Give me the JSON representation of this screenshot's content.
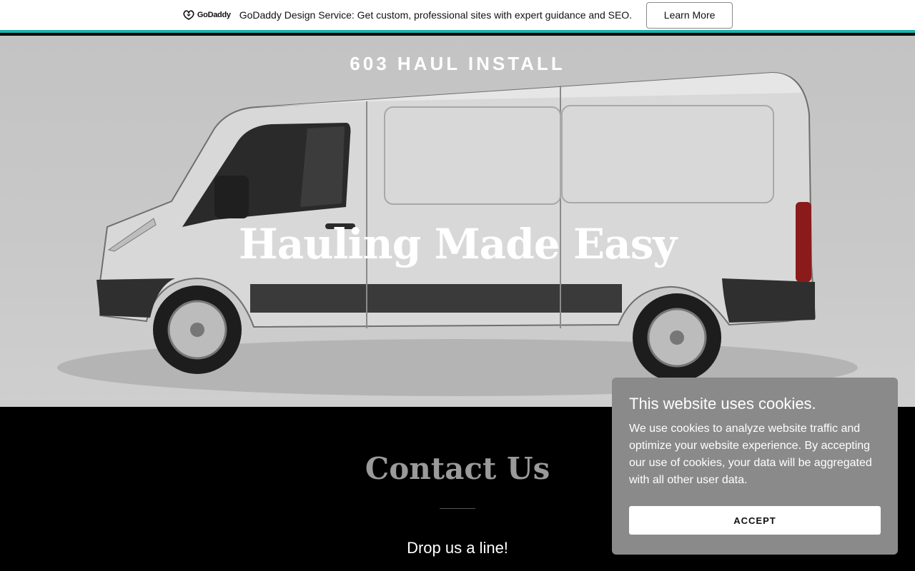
{
  "promo": {
    "logo_text": "GoDaddy",
    "message": "GoDaddy Design Service: Get custom, professional sites with expert guidance and SEO.",
    "button_label": "Learn More",
    "accent_color": "#1bb3ad"
  },
  "hero": {
    "site_title": "603 HAUL INSTALL",
    "heading": "Hauling Made Easy"
  },
  "contact": {
    "title": "Contact Us",
    "subtitle": "Drop us a line!"
  },
  "cookie": {
    "title": "This website uses cookies.",
    "text": "We use cookies to analyze website traffic and optimize your website experience. By accepting our use of cookies, your data will be aggregated with all other user data.",
    "accept_label": "ACCEPT"
  }
}
